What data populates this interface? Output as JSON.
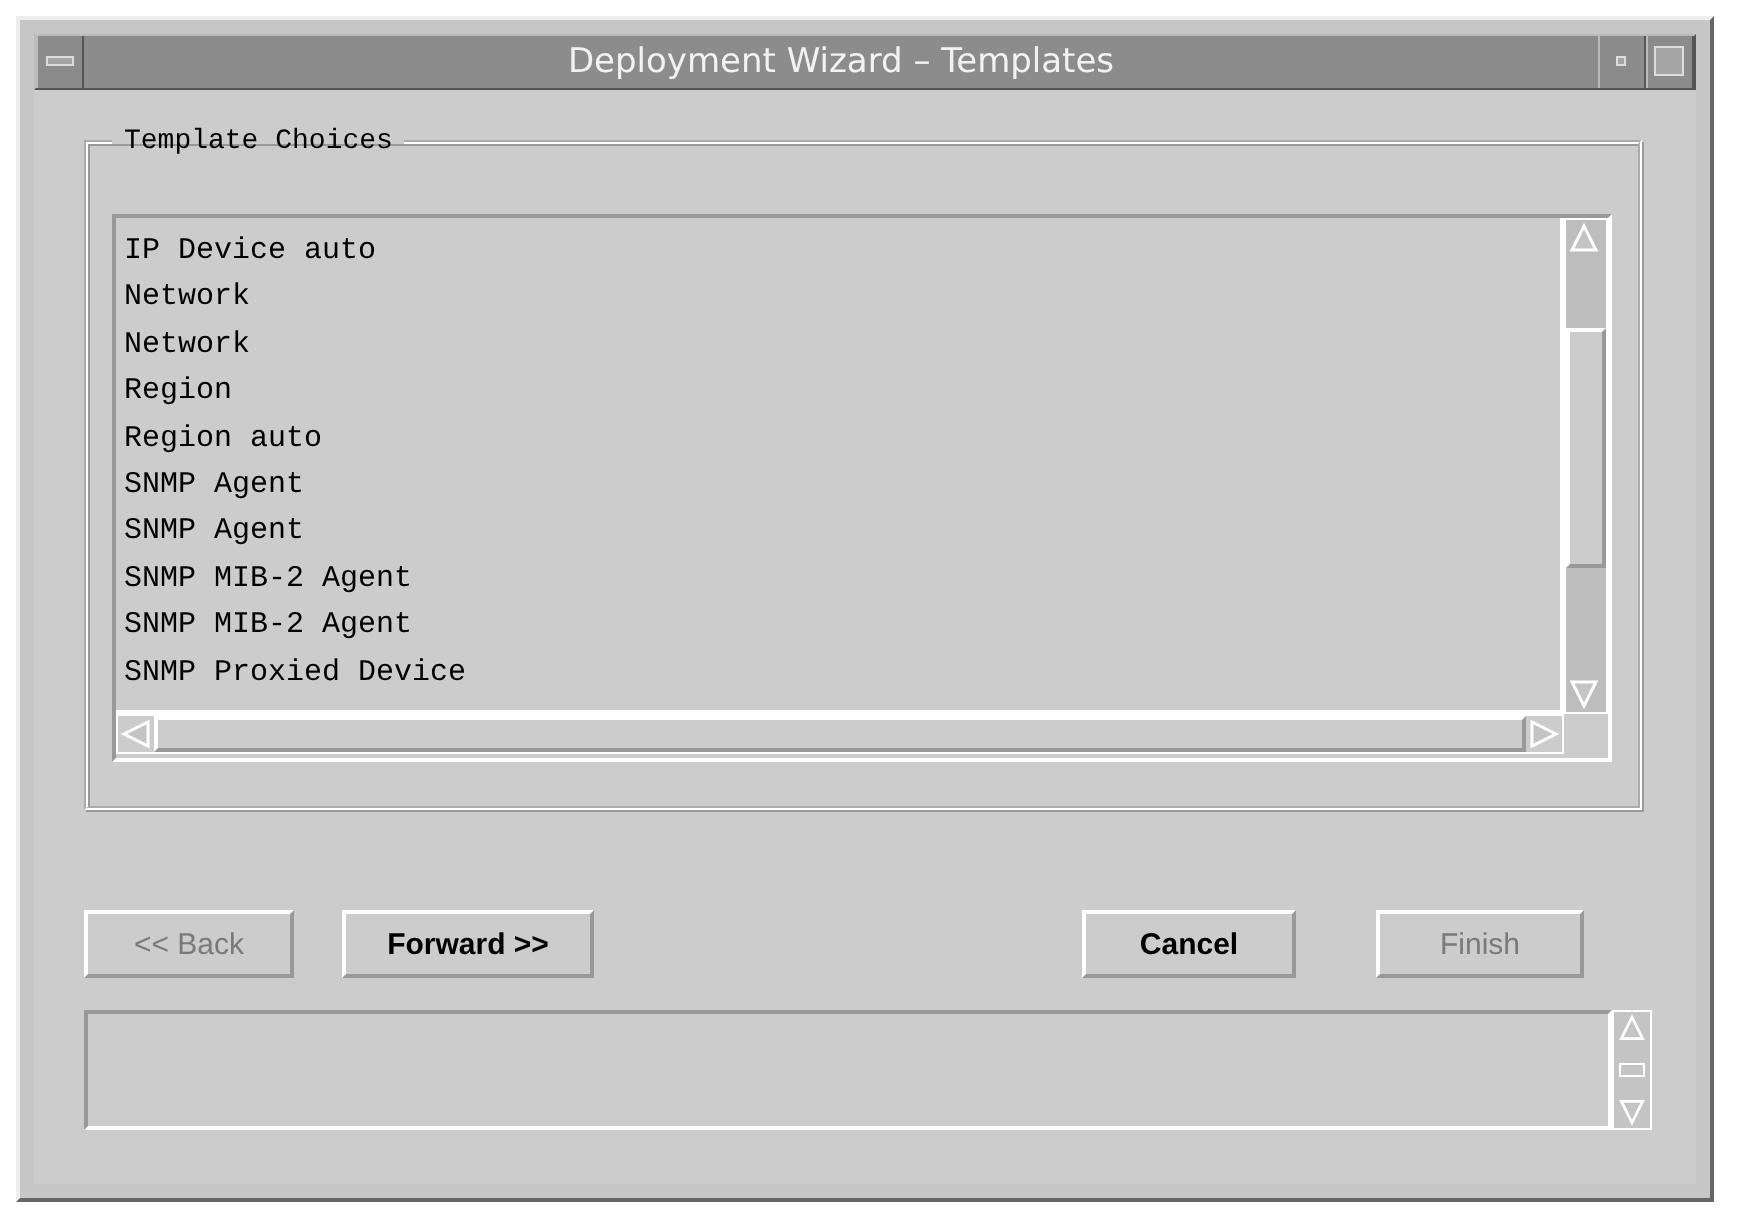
{
  "window": {
    "title": "Deployment Wizard – Templates"
  },
  "group": {
    "label": "Template Choices"
  },
  "templates": [
    {
      "label": "IP Device auto"
    },
    {
      "label": "Network"
    },
    {
      "label": "Network"
    },
    {
      "label": "Region"
    },
    {
      "label": "Region auto"
    },
    {
      "label": "SNMP Agent"
    },
    {
      "label": "SNMP Agent"
    },
    {
      "label": "SNMP MIB-2 Agent"
    },
    {
      "label": "SNMP MIB-2 Agent"
    },
    {
      "label": "SNMP Proxied Device"
    }
  ],
  "nav_buttons": [
    {
      "label": "<< Back",
      "disabled": true
    },
    {
      "label": "Forward >>",
      "disabled": false
    }
  ],
  "action_buttons": [
    {
      "label": "Cancel",
      "disabled": false
    },
    {
      "label": "Finish",
      "disabled": true
    }
  ]
}
